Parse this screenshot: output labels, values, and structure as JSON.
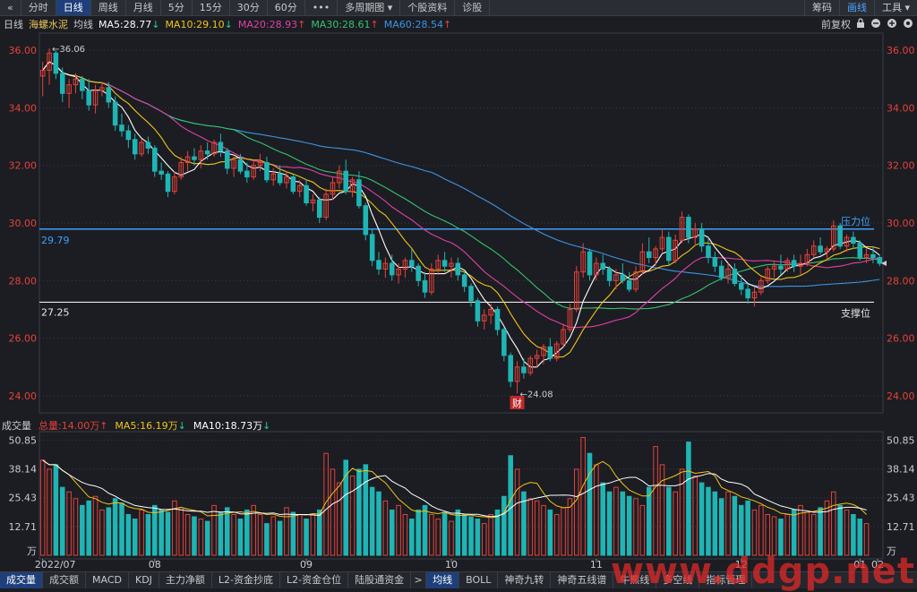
{
  "toolbar": {
    "back_icon": "«",
    "tabs": [
      "分时",
      "日线",
      "周线",
      "月线",
      "5分",
      "15分",
      "30分",
      "60分",
      "•••",
      "多周期图 ▾",
      "个股资料",
      "诊股"
    ],
    "active_index": 1,
    "right_tabs": [
      "筹码",
      "画线",
      "工具 ▾"
    ],
    "right_highlight_index": 1
  },
  "ma_bar": {
    "period": "日线",
    "stock_name": "海螺水泥",
    "label": "均线",
    "ma5": "MA5:28.77",
    "ma10": "MA10:29.10",
    "ma20": "MA20:28.93",
    "ma30": "MA30:28.61",
    "ma60": "MA60:28.54",
    "ma5_arrow": "↓",
    "ma10_arrow": "↓",
    "ma20_arrow": "↑",
    "ma30_arrow": "↑",
    "ma60_arrow": "↑",
    "adjust": "前复权"
  },
  "volume_bar": {
    "title": "成交量",
    "total": "总量:14.00万",
    "total_arrow": "↑",
    "ma5": "MA5:16.19万",
    "ma5_arrow": "↓",
    "ma10": "MA10:18.73万",
    "ma10_arrow": "↓"
  },
  "bottom_tabs": [
    "成交量",
    "成交额",
    "MACD",
    "KDJ",
    "主力净额",
    "L2-资金抄底",
    "L2-资金仓位",
    "陆股通资金",
    "均线",
    "BOLL",
    "神奇九转",
    "神奇五线谱",
    "牛熊线",
    "多空线",
    "指标管理"
  ],
  "bottom_active": [
    0,
    8
  ],
  "bottom_gap": ">",
  "watermark": "www.ddgp.net",
  "colors": {
    "up": "#e8413a",
    "down": "#1fb5b5",
    "ma5": "#ffffff",
    "ma10": "#f0c419",
    "ma20": "#e040a6",
    "ma30": "#38c172",
    "ma60": "#3f93e6",
    "line": "#3fa0ff",
    "grid": "#3a3d45"
  },
  "chart_data": {
    "type": "candlestick",
    "y_ticks": [
      "36.00",
      "34.00",
      "32.00",
      "30.00",
      "28.00",
      "26.00",
      "24.00"
    ],
    "ylim": [
      23.5,
      36.5
    ],
    "vol_ticks": [
      "50.85",
      "38.14",
      "25.43",
      "12.71",
      "万"
    ],
    "vol_lim": [
      0,
      53
    ],
    "x_ticks": [
      "2022/07",
      "08",
      "09",
      "10",
      "11",
      "12",
      "01",
      "02"
    ],
    "annotations": {
      "high": "36.06",
      "low": "24.08",
      "event": "财",
      "resistance_label": "压力位",
      "support_label": "支撑位",
      "resistance": "29.79",
      "support": "27.25"
    },
    "resistance": 29.79,
    "support": 27.25,
    "ohlc": [
      [
        35.1,
        35.6,
        34.4,
        35.3
      ],
      [
        35.3,
        36.06,
        34.8,
        35.9
      ],
      [
        35.9,
        36.0,
        35.0,
        35.2
      ],
      [
        35.2,
        35.4,
        34.2,
        34.5
      ],
      [
        34.5,
        35.0,
        34.0,
        34.8
      ],
      [
        34.8,
        35.2,
        34.5,
        35.0
      ],
      [
        35.0,
        35.1,
        34.3,
        34.6
      ],
      [
        34.6,
        35.0,
        33.9,
        34.1
      ],
      [
        34.1,
        34.8,
        33.8,
        34.6
      ],
      [
        34.6,
        34.9,
        34.4,
        34.7
      ],
      [
        34.7,
        34.9,
        34.0,
        34.2
      ],
      [
        34.2,
        34.4,
        33.2,
        33.4
      ],
      [
        33.4,
        33.8,
        33.0,
        33.2
      ],
      [
        33.2,
        33.4,
        32.6,
        32.9
      ],
      [
        32.9,
        33.1,
        32.2,
        32.4
      ],
      [
        32.4,
        32.9,
        32.3,
        32.8
      ],
      [
        32.8,
        33.0,
        32.4,
        32.6
      ],
      [
        32.6,
        32.7,
        31.6,
        31.8
      ],
      [
        31.8,
        32.1,
        31.5,
        31.7
      ],
      [
        31.7,
        31.8,
        30.9,
        31.1
      ],
      [
        31.1,
        31.8,
        31.0,
        31.6
      ],
      [
        31.6,
        32.3,
        31.5,
        32.1
      ],
      [
        32.1,
        32.5,
        31.8,
        32.3
      ],
      [
        32.3,
        32.6,
        32.0,
        32.2
      ],
      [
        32.2,
        32.7,
        31.9,
        32.5
      ],
      [
        32.5,
        32.8,
        32.2,
        32.4
      ],
      [
        32.4,
        32.9,
        32.3,
        32.8
      ],
      [
        32.8,
        33.1,
        32.3,
        32.5
      ],
      [
        32.5,
        32.6,
        31.7,
        31.9
      ],
      [
        31.9,
        32.3,
        31.6,
        32.2
      ],
      [
        32.2,
        32.4,
        31.7,
        31.8
      ],
      [
        31.8,
        32.1,
        31.4,
        31.6
      ],
      [
        31.6,
        32.2,
        31.5,
        32.0
      ],
      [
        32.0,
        32.4,
        31.8,
        32.1
      ],
      [
        32.1,
        32.3,
        31.4,
        31.5
      ],
      [
        31.5,
        31.9,
        31.3,
        31.7
      ],
      [
        31.7,
        32.0,
        31.3,
        31.4
      ],
      [
        31.4,
        31.8,
        31.2,
        31.6
      ],
      [
        31.6,
        31.7,
        31.0,
        31.1
      ],
      [
        31.1,
        31.5,
        30.9,
        31.3
      ],
      [
        31.3,
        31.5,
        30.6,
        30.7
      ],
      [
        30.7,
        31.0,
        30.4,
        30.8
      ],
      [
        30.8,
        30.9,
        30.0,
        30.2
      ],
      [
        30.2,
        31.2,
        30.1,
        31.0
      ],
      [
        31.0,
        31.6,
        30.8,
        31.4
      ],
      [
        31.4,
        32.0,
        31.2,
        31.8
      ],
      [
        31.8,
        32.2,
        31.0,
        31.1
      ],
      [
        31.1,
        31.6,
        30.9,
        31.5
      ],
      [
        31.5,
        31.8,
        30.5,
        30.6
      ],
      [
        30.6,
        30.7,
        29.4,
        29.6
      ],
      [
        29.6,
        29.8,
        28.5,
        28.7
      ],
      [
        28.7,
        29.0,
        28.2,
        28.4
      ],
      [
        28.4,
        28.8,
        28.1,
        28.6
      ],
      [
        28.6,
        28.9,
        28.0,
        28.2
      ],
      [
        28.2,
        28.6,
        27.9,
        28.4
      ],
      [
        28.4,
        28.8,
        28.1,
        28.7
      ],
      [
        28.7,
        29.1,
        28.3,
        28.5
      ],
      [
        28.5,
        28.6,
        27.8,
        28.0
      ],
      [
        28.0,
        28.3,
        27.4,
        27.6
      ],
      [
        27.6,
        28.6,
        27.5,
        28.4
      ],
      [
        28.4,
        28.9,
        28.2,
        28.7
      ],
      [
        28.7,
        29.0,
        28.3,
        28.5
      ],
      [
        28.5,
        28.8,
        28.1,
        28.6
      ],
      [
        28.6,
        28.8,
        28.0,
        28.2
      ],
      [
        28.2,
        28.3,
        27.6,
        27.8
      ],
      [
        27.8,
        27.9,
        27.1,
        27.3
      ],
      [
        27.3,
        27.4,
        26.4,
        26.6
      ],
      [
        26.6,
        27.0,
        26.3,
        26.8
      ],
      [
        26.8,
        27.2,
        26.5,
        27.0
      ],
      [
        27.0,
        27.1,
        26.1,
        26.3
      ],
      [
        26.3,
        26.4,
        25.2,
        25.4
      ],
      [
        25.4,
        25.5,
        24.3,
        24.5
      ],
      [
        24.5,
        25.2,
        24.08,
        25.0
      ],
      [
        25.0,
        25.3,
        24.6,
        24.8
      ],
      [
        24.8,
        25.4,
        24.7,
        25.3
      ],
      [
        25.3,
        25.6,
        25.0,
        25.4
      ],
      [
        25.4,
        25.8,
        25.1,
        25.7
      ],
      [
        25.7,
        26.0,
        25.2,
        25.3
      ],
      [
        25.3,
        25.9,
        25.2,
        25.8
      ],
      [
        25.8,
        26.5,
        25.7,
        26.3
      ],
      [
        26.3,
        27.2,
        26.2,
        27.0
      ],
      [
        27.0,
        28.5,
        26.9,
        28.3
      ],
      [
        28.3,
        29.3,
        28.1,
        29.0
      ],
      [
        29.0,
        29.1,
        28.0,
        28.2
      ],
      [
        28.2,
        28.8,
        28.0,
        28.6
      ],
      [
        28.6,
        28.9,
        28.2,
        28.4
      ],
      [
        28.4,
        28.5,
        27.8,
        28.0
      ],
      [
        28.0,
        28.4,
        27.7,
        28.2
      ],
      [
        28.2,
        28.6,
        27.9,
        28.0
      ],
      [
        28.0,
        28.3,
        27.6,
        27.7
      ],
      [
        27.7,
        28.5,
        27.6,
        28.3
      ],
      [
        28.3,
        29.3,
        28.2,
        29.0
      ],
      [
        29.0,
        29.5,
        28.6,
        28.8
      ],
      [
        28.8,
        29.2,
        28.5,
        29.1
      ],
      [
        29.1,
        29.8,
        29.0,
        29.5
      ],
      [
        29.5,
        29.7,
        28.5,
        28.7
      ],
      [
        28.7,
        29.6,
        28.6,
        29.4
      ],
      [
        29.4,
        30.4,
        29.3,
        30.2
      ],
      [
        30.2,
        30.3,
        29.3,
        29.5
      ],
      [
        29.5,
        30.0,
        29.2,
        29.8
      ],
      [
        29.8,
        30.0,
        29.0,
        29.2
      ],
      [
        29.2,
        29.5,
        28.6,
        28.8
      ],
      [
        28.8,
        29.0,
        28.3,
        28.5
      ],
      [
        28.5,
        28.7,
        28.0,
        28.1
      ],
      [
        28.1,
        28.6,
        27.9,
        28.4
      ],
      [
        28.4,
        28.6,
        27.8,
        27.9
      ],
      [
        27.9,
        28.2,
        27.5,
        27.7
      ],
      [
        27.7,
        27.9,
        27.2,
        27.4
      ],
      [
        27.4,
        27.8,
        27.1,
        27.6
      ],
      [
        27.6,
        28.1,
        27.5,
        28.0
      ],
      [
        28.0,
        28.5,
        27.9,
        28.4
      ],
      [
        28.4,
        28.7,
        28.1,
        28.5
      ],
      [
        28.5,
        28.9,
        28.2,
        28.4
      ],
      [
        28.4,
        28.8,
        28.3,
        28.7
      ],
      [
        28.7,
        28.9,
        28.3,
        28.5
      ],
      [
        28.5,
        28.9,
        28.2,
        28.6
      ],
      [
        28.6,
        29.1,
        28.5,
        28.9
      ],
      [
        28.9,
        29.4,
        28.8,
        29.2
      ],
      [
        29.2,
        29.5,
        28.9,
        29.0
      ],
      [
        29.0,
        29.2,
        28.7,
        29.1
      ],
      [
        29.1,
        30.1,
        29.0,
        29.9
      ],
      [
        29.9,
        30.0,
        29.1,
        29.2
      ],
      [
        29.2,
        29.6,
        29.0,
        29.5
      ],
      [
        29.5,
        29.7,
        29.1,
        29.3
      ],
      [
        29.3,
        29.4,
        28.7,
        28.8
      ],
      [
        28.8,
        29.1,
        28.6,
        28.9
      ],
      [
        28.9,
        29.2,
        28.6,
        28.8
      ],
      [
        28.8,
        28.9,
        28.5,
        28.6
      ]
    ],
    "volume": [
      42,
      38,
      40,
      30,
      28,
      25,
      22,
      24,
      26,
      20,
      21,
      25,
      23,
      18,
      16,
      20,
      18,
      22,
      20,
      19,
      24,
      21,
      18,
      17,
      16,
      15,
      22,
      19,
      21,
      18,
      16,
      20,
      22,
      18,
      14,
      17,
      15,
      21,
      19,
      18,
      16,
      18,
      20,
      45,
      38,
      32,
      42,
      35,
      38,
      40,
      30,
      28,
      24,
      20,
      22,
      18,
      16,
      20,
      22,
      18,
      16,
      19,
      15,
      20,
      18,
      17,
      16,
      14,
      18,
      20,
      26,
      44,
      38,
      28,
      25,
      24,
      22,
      20,
      18,
      21,
      25,
      38,
      52,
      45,
      40,
      32,
      28,
      30,
      28,
      26,
      25,
      22,
      30,
      48,
      40,
      30,
      28,
      38,
      50,
      35,
      32,
      30,
      28,
      25,
      28,
      26,
      22,
      24,
      20,
      22,
      18,
      17,
      16,
      18,
      20,
      22,
      19,
      18,
      21,
      24,
      28,
      22,
      20,
      18,
      16,
      14
    ]
  }
}
